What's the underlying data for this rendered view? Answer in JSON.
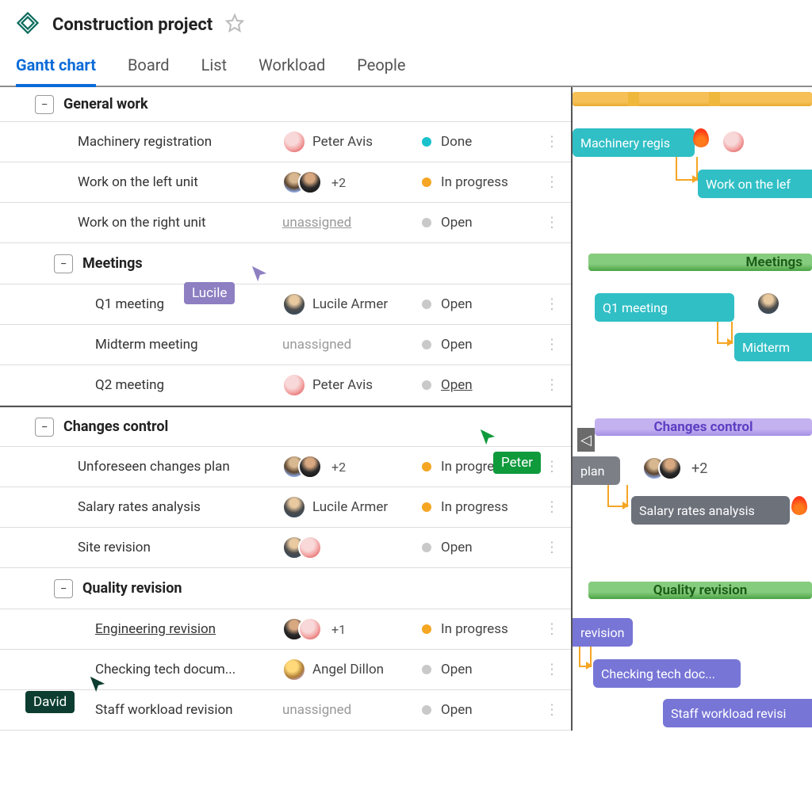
{
  "header": {
    "project_title": "Construction project"
  },
  "tabs": [
    {
      "label": "Gantt chart",
      "active": true
    },
    {
      "label": "Board"
    },
    {
      "label": "List"
    },
    {
      "label": "Workload"
    },
    {
      "label": "People"
    }
  ],
  "status_colors": {
    "done": "#19c2cc",
    "progress": "#f5a623",
    "open": "#c9c9c9"
  },
  "groups": {
    "general": {
      "label": "General work",
      "tasks": [
        {
          "name": "Machinery registration",
          "assignee_text": "Peter Avis",
          "status": "Done",
          "status_dot": "done"
        },
        {
          "name": "Work on the left unit",
          "overflow": "+2",
          "status": "In progress",
          "status_dot": "progress"
        },
        {
          "name": "Work on the right unit",
          "assignee_text": "unassigned",
          "status": "Open",
          "status_dot": "open"
        }
      ],
      "subgroups": {
        "meetings": {
          "label": "Meetings",
          "tasks": [
            {
              "name": "Q1 meeting",
              "assignee_text": "Lucile Armer",
              "status": "Open",
              "status_dot": "open"
            },
            {
              "name": "Midterm meeting",
              "assignee_text": "unassigned",
              "status": "Open",
              "status_dot": "open"
            },
            {
              "name": "Q2 meeting",
              "assignee_text": "Peter Avis",
              "status": "Open",
              "status_dot": "open"
            }
          ]
        }
      }
    },
    "changes": {
      "label": "Changes control",
      "tasks": [
        {
          "name": "Unforeseen changes plan",
          "overflow": "+2",
          "status": "In progress",
          "status_dot": "progress"
        },
        {
          "name": "Salary rates analysis",
          "assignee_text": "Lucile Armer",
          "status": "In progress",
          "status_dot": "progress"
        },
        {
          "name": "Site revision",
          "status": "Open",
          "status_dot": "open"
        }
      ],
      "subgroups": {
        "quality": {
          "label": "Quality revision",
          "tasks": [
            {
              "name": "Engineering revision",
              "overflow": "+1",
              "status": "In progress",
              "status_dot": "progress"
            },
            {
              "name": "Checking tech docum...",
              "assignee_text": "Angel Dillon",
              "status": "Open",
              "status_dot": "open"
            },
            {
              "name": "Staff workload revision",
              "assignee_text": "unassigned",
              "status": "Open",
              "status_dot": "open"
            }
          ]
        }
      }
    }
  },
  "gantt": {
    "bars": {
      "machinery": "Machinery regis",
      "left_unit": "Work on the lef",
      "meetings_group": "Meetings",
      "q1": "Q1 meeting",
      "midterm": "Midterm",
      "changes_group": "Changes control",
      "plan": "plan",
      "plan_overflow": "+2",
      "salary": "Salary rates analysis",
      "quality_group": "Quality revision",
      "revision": "revision",
      "checking": "Checking tech doc...",
      "staff": "Staff workload revisi"
    }
  },
  "cursors": {
    "lucile": {
      "label": "Lucile",
      "color": "#8d7fc2"
    },
    "peter": {
      "label": "Peter",
      "color": "#0f9a3c"
    },
    "david": {
      "label": "David",
      "color": "#0c3d30"
    }
  }
}
